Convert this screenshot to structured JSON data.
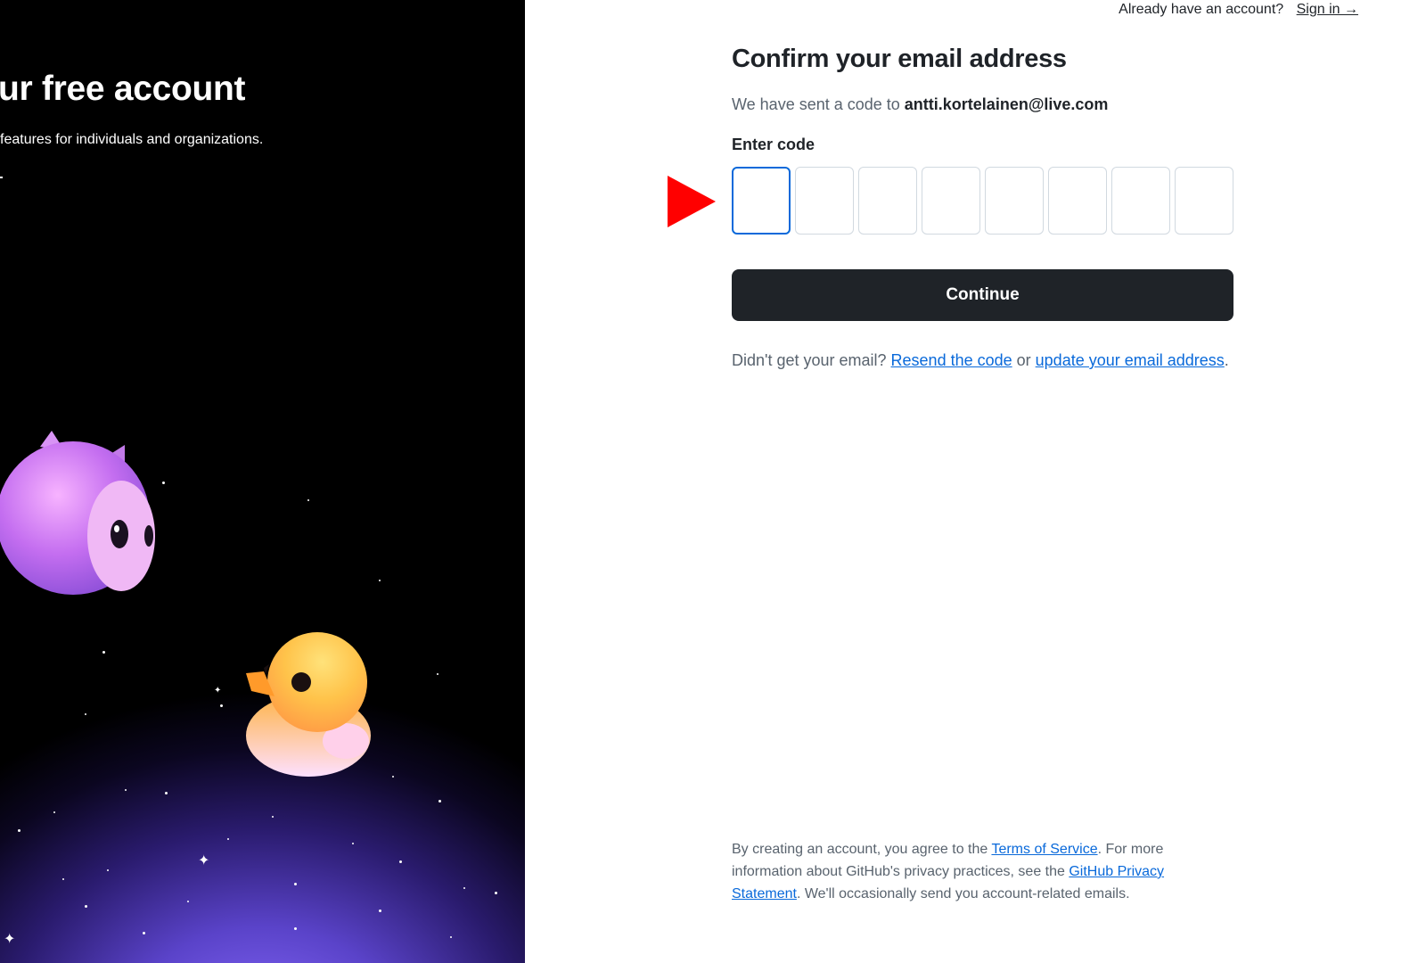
{
  "left": {
    "title": "ur free account",
    "subtitle": "features for individuals and organizations."
  },
  "header": {
    "prompt": "Already have an account?",
    "signin_label": "Sign in →"
  },
  "form": {
    "title": "Confirm your email address",
    "sent_prefix": "We have sent a code to ",
    "email": "antti.kortelainen@live.com",
    "code_label": "Enter code",
    "code_boxes": [
      "",
      "",
      "",
      "",
      "",
      "",
      "",
      ""
    ],
    "continue_label": "Continue",
    "resend_prefix": "Didn't get your email? ",
    "resend_link": "Resend the code",
    "or_text": " or ",
    "update_link": "update your email address",
    "period": "."
  },
  "footer": {
    "text1": "By creating an account, you agree to the ",
    "terms_link": "Terms of Service",
    "text2": ". For more information about GitHub's privacy practices, see the ",
    "privacy_link": "GitHub Privacy Statement",
    "text3": ". We'll occasionally send you account-related emails."
  },
  "colors": {
    "accent_link": "#0969da",
    "button_bg": "#1f2328",
    "pointer": "#ff0000"
  }
}
